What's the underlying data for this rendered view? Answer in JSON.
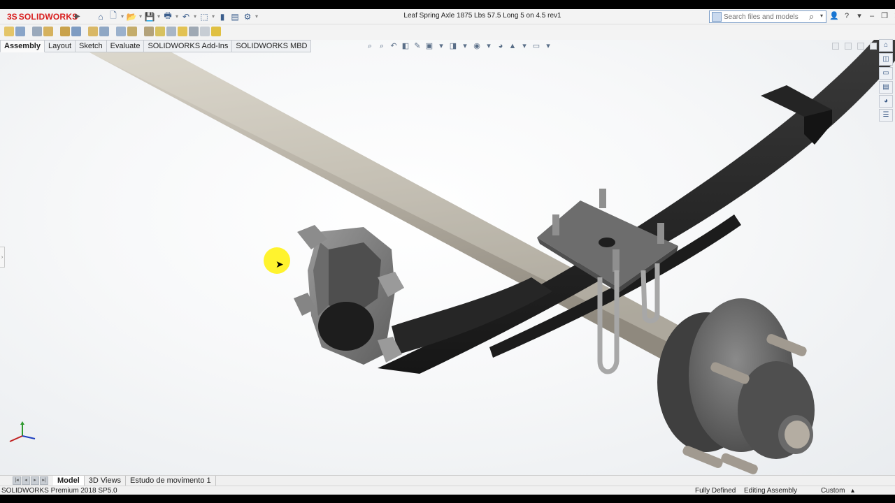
{
  "app": {
    "logo_mark": "3S",
    "logo_word": "SOLIDWORKS"
  },
  "window": {
    "title": "Leaf Spring Axle 1875 Lbs 57.5 Long 5 on 4.5 rev1"
  },
  "search": {
    "placeholder": "Search files and models"
  },
  "command_tabs": [
    "Assembly",
    "Layout",
    "Sketch",
    "Evaluate",
    "SOLIDWORKS Add-Ins",
    "SOLIDWORKS MBD"
  ],
  "bottom_tabs": [
    "Model",
    "3D Views",
    "Estudo de movimento 1"
  ],
  "status": {
    "product": "SOLIDWORKS Premium 2018 SP5.0",
    "state": "Fully Defined",
    "mode": "Editing Assembly",
    "units": "Custom"
  },
  "titlebar_icons": [
    "home-icon",
    "new-icon",
    "open-icon",
    "save-icon",
    "print-icon",
    "undo-icon",
    "select-icon",
    "rebuild-icon",
    "file-props-icon",
    "options-icon"
  ],
  "taskpane_icons": [
    "home-icon",
    "resources-icon",
    "design-library-icon",
    "file-explorer-icon",
    "appearances-icon",
    "custom-props-icon"
  ],
  "colors": {
    "accent": "#d81e1e",
    "cursor_highlight": "#fff000",
    "leaf_spring": "#2b2b2b",
    "axle": "#bdb7aa",
    "hardware": "#7d7d7d"
  }
}
